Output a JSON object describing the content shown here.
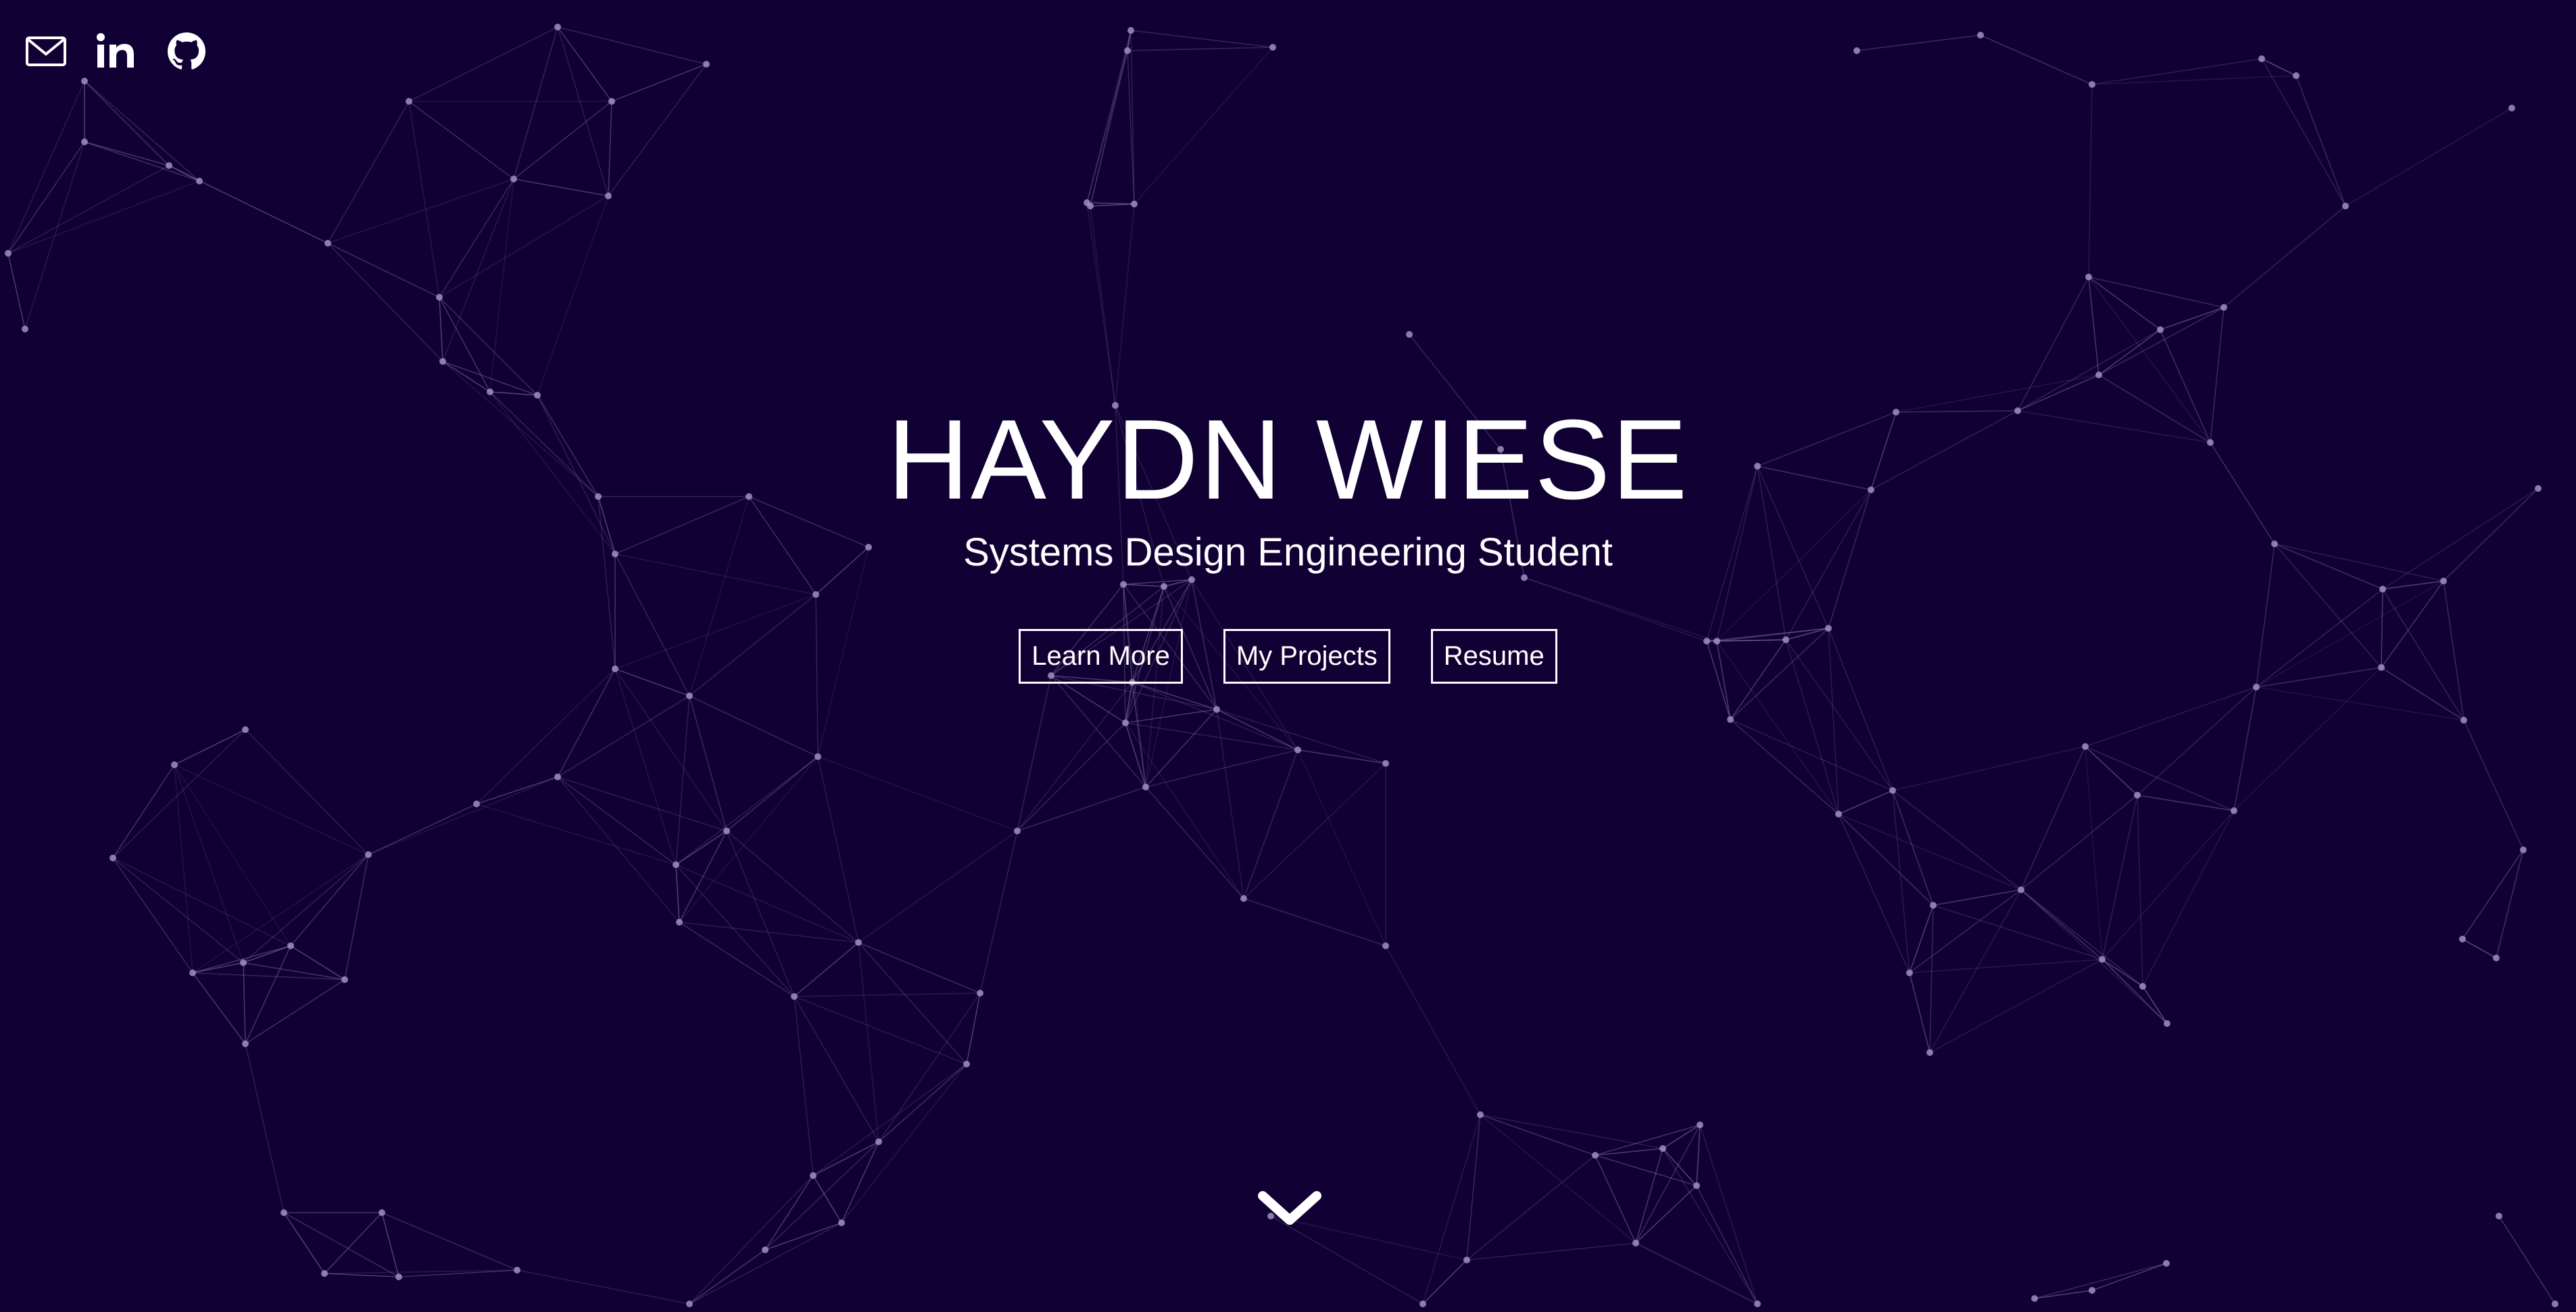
{
  "social": {
    "email_icon": "mail-icon",
    "linkedin_icon": "linkedin-icon",
    "github_icon": "github-icon"
  },
  "hero": {
    "name": "HAYDN WIESE",
    "subtitle": "Systems Design Engineering Student"
  },
  "buttons": {
    "learn_more": "Learn More",
    "my_projects": "My Projects",
    "resume": "Resume"
  },
  "scroll_icon": "chevron-down-icon",
  "colors": {
    "background": "#100033",
    "text": "#ffffff",
    "particle": "#9c92b8"
  }
}
